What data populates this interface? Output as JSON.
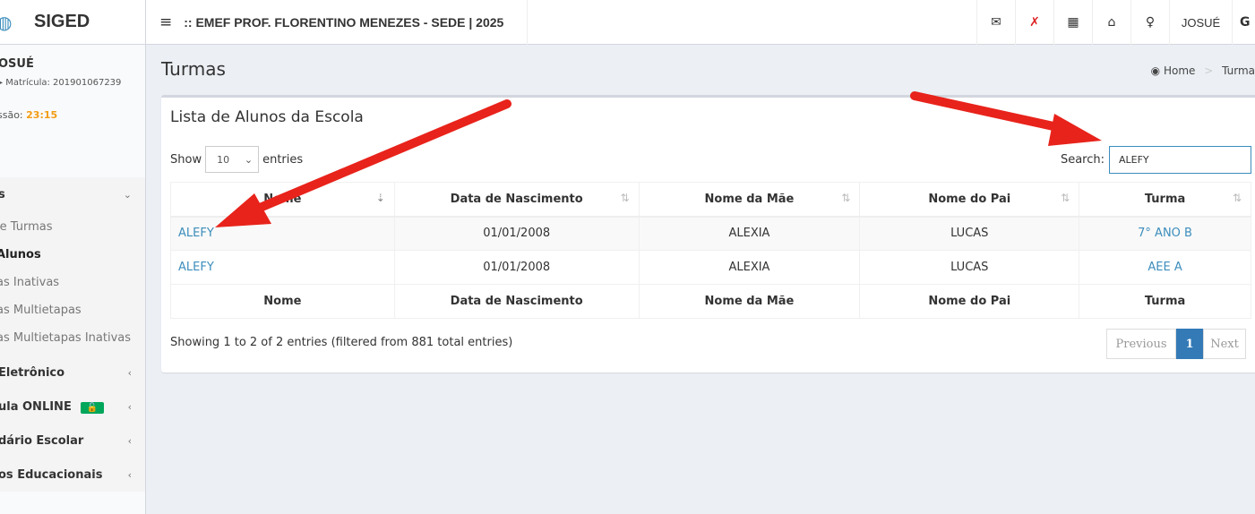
{
  "app": {
    "name": "SIGED"
  },
  "topbar": {
    "school": ":: EMEF PROF. FLORENTINO MENEZES - SEDE | 2025",
    "user": "JOSUÉ"
  },
  "sidebar": {
    "user_name": "OSUÉ",
    "matricula": "Matrícula: 201901067239",
    "session_label": "ssão: ",
    "session_time": "23:15",
    "menu_title": "s",
    "submenu": [
      "le Turmas",
      "Alunos",
      "as Inativas",
      "as Multietapas",
      "as Multietapas Inativas"
    ],
    "items": [
      "Eletrônico",
      "ula ONLINE",
      "dário Escolar",
      "os Educacionais"
    ]
  },
  "content": {
    "page_title": "Turmas",
    "breadcrumb": {
      "home": "Home",
      "current": "Turma"
    },
    "box_title": "Lista de Alunos da Escola",
    "show_label": "Show",
    "entries_value": "10",
    "entries_label": "entries",
    "search_label": "Search:",
    "search_value": "ALEFY",
    "columns": [
      "Nome",
      "Data de Nascimento",
      "Nome da Mãe",
      "Nome do Pai",
      "Turma"
    ],
    "rows": [
      {
        "nome": "ALEFY",
        "nascimento": "01/01/2008",
        "mae": "ALEXIA",
        "pai": "LUCAS",
        "turma": "7° ANO B"
      },
      {
        "nome": "ALEFY",
        "nascimento": "01/01/2008",
        "mae": "ALEXIA",
        "pai": "LUCAS",
        "turma": "AEE A"
      }
    ],
    "info": "Showing 1 to 2 of 2 entries (filtered from 881 total entries)",
    "pagination": {
      "prev": "Previous",
      "current": "1",
      "next": "Next"
    }
  },
  "colors": {
    "accent": "#3c8dbc",
    "arrow": "#e8231b",
    "session_time": "#f39c12",
    "badge": "#00a65a"
  },
  "icons": [
    "globe-icon",
    "hamburger-icon",
    "envelope-icon",
    "bell-slash-icon",
    "calendar-icon",
    "bank-icon",
    "lightbulb-icon",
    "gear-icon",
    "dashboard-icon",
    "chevron-down-icon",
    "chevron-left-icon",
    "unlock-icon",
    "sort-icon"
  ]
}
